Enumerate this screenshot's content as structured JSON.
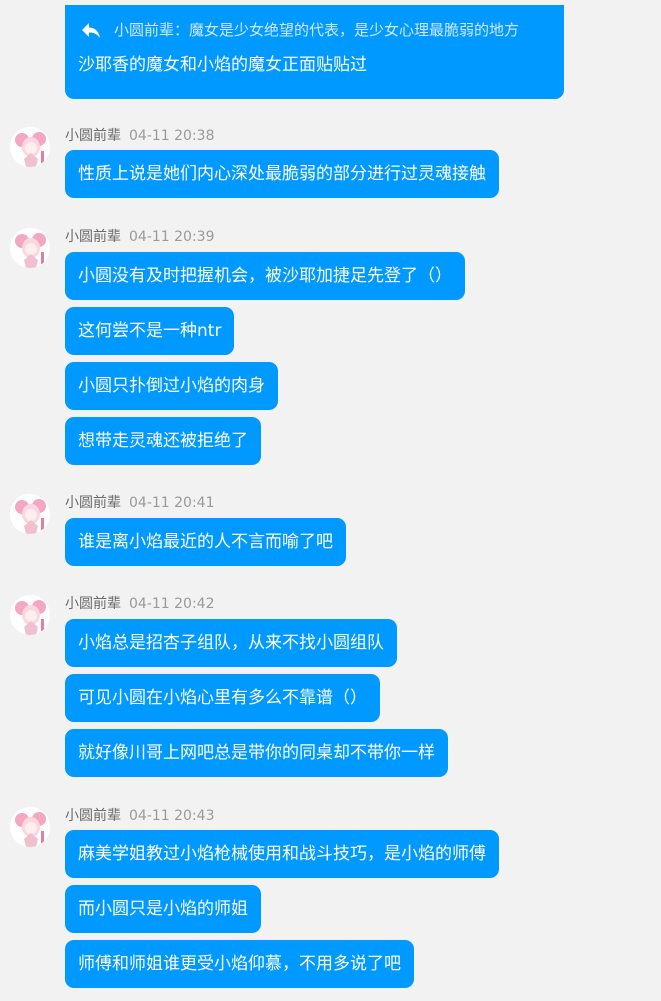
{
  "colors": {
    "background": "#f2f2f2",
    "bubble": "#0099ff",
    "bubble_text": "#ffffff",
    "quote_text": "#cfe8ff",
    "sender_text": "#6b6b6b",
    "time_text": "#9a9a9a"
  },
  "reply_message": {
    "quote_icon": "reply-arrow-icon",
    "quote_sender": "小圆前辈：",
    "quote_text": "魔女是少女绝望的代表，是少女心理最脆弱的地方",
    "text": "沙耶香的魔女和小焰的魔女正面贴贴过"
  },
  "groups": [
    {
      "sender": "小圆前辈",
      "time": "04-11 20:38",
      "messages": [
        "性质上说是她们内心深处最脆弱的部分进行过灵魂接触"
      ]
    },
    {
      "sender": "小圆前辈",
      "time": "04-11 20:39",
      "messages": [
        "小圆没有及时把握机会，被沙耶加捷足先登了（）",
        "这何尝不是一种ntr",
        "小圆只扑倒过小焰的肉身",
        "想带走灵魂还被拒绝了"
      ]
    },
    {
      "sender": "小圆前辈",
      "time": "04-11 20:41",
      "messages": [
        "谁是离小焰最近的人不言而喻了吧"
      ]
    },
    {
      "sender": "小圆前辈",
      "time": "04-11 20:42",
      "messages": [
        "小焰总是招杏子组队，从来不找小圆组队",
        "可见小圆在小焰心里有多么不靠谱（）",
        "就好像川哥上网吧总是带你的同桌却不带你一样"
      ]
    },
    {
      "sender": "小圆前辈",
      "time": "04-11 20:43",
      "messages": [
        "麻美学姐教过小焰枪械使用和战斗技巧，是小焰的师傅",
        "而小圆只是小焰的师姐",
        "师傅和师姐谁更受小焰仰慕，不用多说了吧"
      ]
    }
  ]
}
